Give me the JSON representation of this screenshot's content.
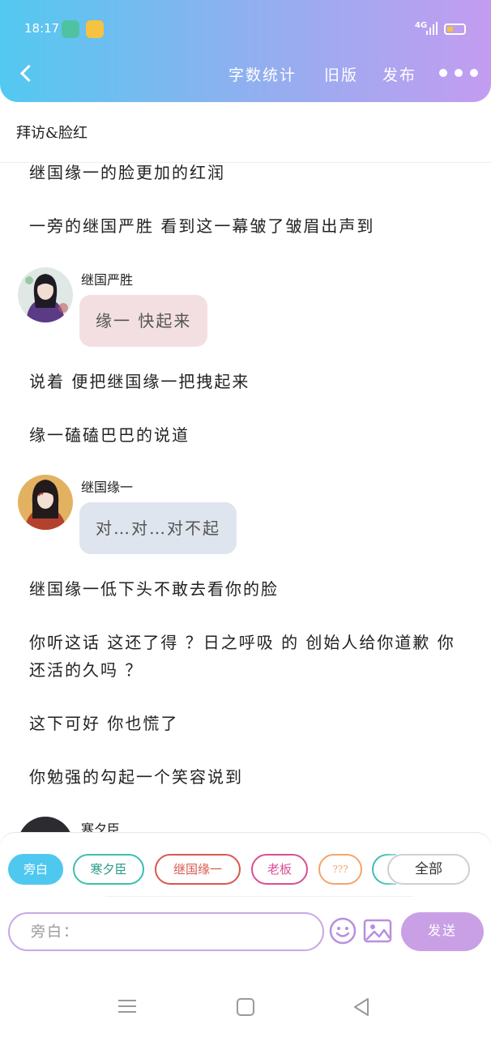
{
  "status_bar": {
    "time": "18:17",
    "network": "4G"
  },
  "nav": {
    "word_count": "字数统计",
    "old_version": "旧版",
    "publish": "发布"
  },
  "chapter_title": "拜访&脸红",
  "story": {
    "narration_1": "继国缘一的脸更加的红润",
    "narration_2": "一旁的继国严胜 看到这一幕皱了皱眉出声到",
    "message_1": {
      "speaker": "继国严胜",
      "text": "缘一 快起来"
    },
    "narration_3": "说着 便把继国缘一把拽起来",
    "narration_4": "缘一磕磕巴巴的说道",
    "message_2": {
      "speaker": "继国缘一",
      "text": "对…对…对不起"
    },
    "narration_5": "继国缘一低下头不敢去看你的脸",
    "narration_6": "你听这话 这还了得 ？日之呼吸 的 创始人给你道歉 你还活的久吗 ？",
    "narration_7": "这下可好 你也慌了",
    "narration_8": "你勉强的勾起一个笑容说到",
    "message_3": {
      "speaker": "寒夕臣"
    }
  },
  "roles": {
    "narrator": "旁白",
    "hanxi": "寒夕臣",
    "yuanyi": "继国缘一",
    "boss": "老板",
    "unknown": "???",
    "all": "全部"
  },
  "composer": {
    "placeholder": "旁白：",
    "send": "发送"
  },
  "colors": {
    "header_start": "#52c9f0",
    "header_end": "#c39cf0",
    "send_button": "#c9a0e6",
    "bubble_pink": "#f3dfe1",
    "bubble_blue": "#dfe5ee"
  },
  "icons": {
    "back": "chevron-left-icon",
    "more": "more-dots-icon",
    "emoji": "smiley-icon",
    "image": "image-icon"
  }
}
